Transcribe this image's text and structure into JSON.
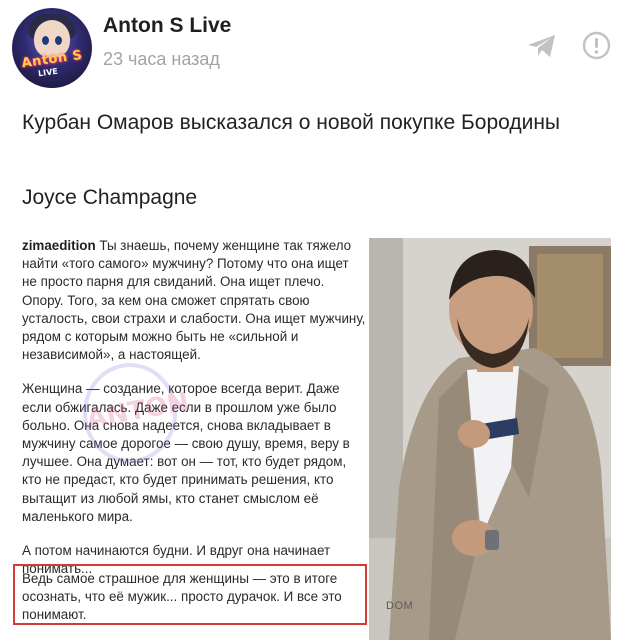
{
  "header": {
    "channel_name": "Anton S Live",
    "time_ago": "23 часа назад",
    "avatar_text": "Anton S",
    "avatar_subtext": "LIVE"
  },
  "icons": {
    "share": "paper-plane-icon",
    "report": "exclamation-circle-icon"
  },
  "post": {
    "title": "Курбан Омаров высказался о новой покупке Бородины",
    "inner_title": "Joyce Champagne"
  },
  "insta": {
    "username": "zimaedition",
    "para1": " Ты знаешь, почему женщине так тяжело найти «того самого» мужчину? Потому что она ищет не просто парня для свиданий. Она ищет плечо. Опору. Того, за кем она сможет спрятать свою усталость, свои страхи и слабости. Она ищет мужчину, рядом с которым можно быть не «сильной и независимой», а настоящей.",
    "para2": "Женщина — создание, которое всегда верит. Даже если обжигалась. Даже если в прошлом уже было больно. Она снова надеется, снова вкладывает в мужчину самое дорогое — свою душу, время, веру в лучшее. Она думает: вот он — тот, кто будет рядом, кто не предаст, кто будет принимать решения, кто вытащит из любой ямы, кто станет смыслом её маленького мира.",
    "para3": "А потом начинаются будни. И вдруг она начинает понимать...",
    "highlight": "Ведь самое страшное для женщины — это в итоге осознать, что её мужик... просто дурачок. И все это понимают.",
    "watermark_text": "ANTON"
  },
  "photo": {
    "label": "DOM"
  },
  "colors": {
    "highlight_border": "#d43a3a",
    "muted_text": "#a3a3a3",
    "icon_gray": "#b9b9b9"
  }
}
